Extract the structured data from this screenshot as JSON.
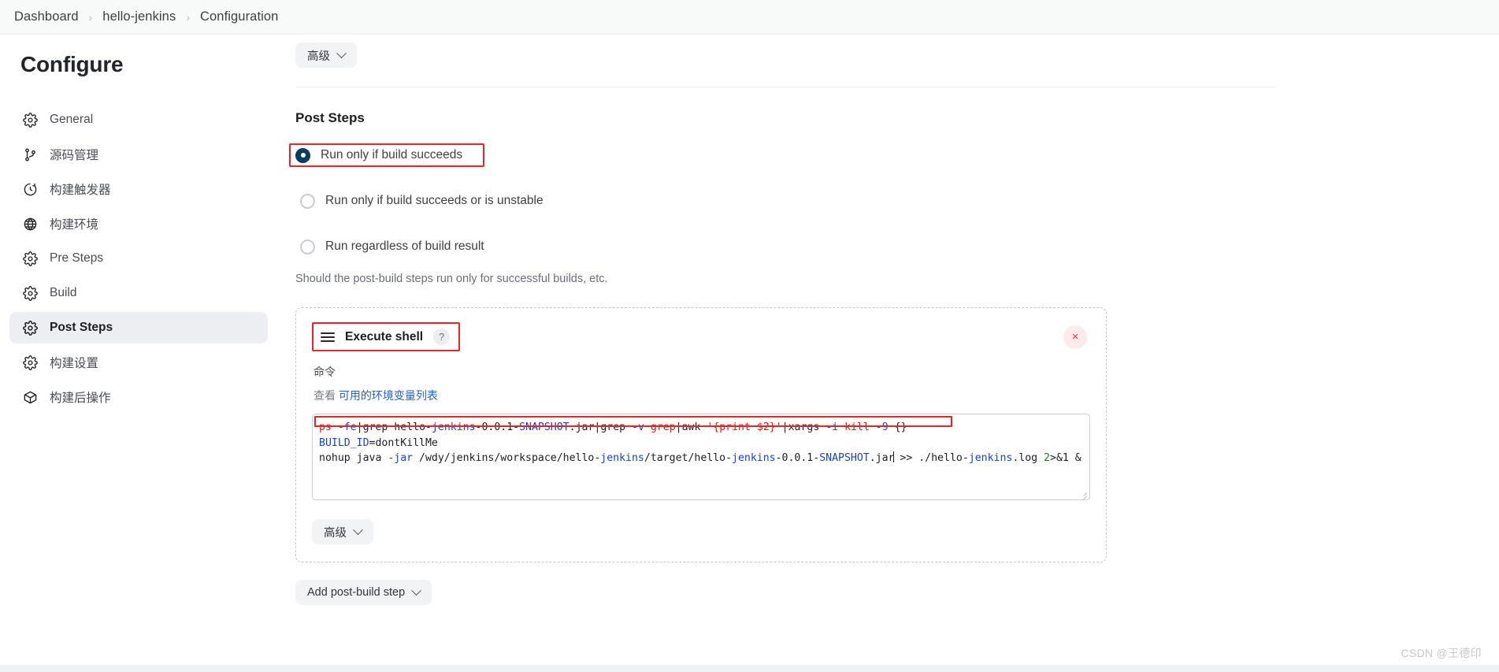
{
  "breadcrumb": {
    "items": [
      "Dashboard",
      "hello-jenkins",
      "Configuration"
    ],
    "separator": "›"
  },
  "sidebar": {
    "title": "Configure",
    "items": [
      {
        "label": "General",
        "icon": "gear-icon",
        "active": false
      },
      {
        "label": "源码管理",
        "icon": "branch-icon",
        "active": false
      },
      {
        "label": "构建触发器",
        "icon": "clock-icon",
        "active": false
      },
      {
        "label": "构建环境",
        "icon": "globe-icon",
        "active": false
      },
      {
        "label": "Pre Steps",
        "icon": "gear-icon",
        "active": false
      },
      {
        "label": "Build",
        "icon": "gear-icon",
        "active": false
      },
      {
        "label": "Post Steps",
        "icon": "gear-icon",
        "active": true
      },
      {
        "label": "构建设置",
        "icon": "gear-icon",
        "active": false
      },
      {
        "label": "构建后操作",
        "icon": "box-icon",
        "active": false
      }
    ]
  },
  "main": {
    "top_advanced_label": "高级",
    "heading": "Post Steps",
    "radios": [
      {
        "label": "Run only if build succeeds",
        "checked": true,
        "highlighted": true
      },
      {
        "label": "Run only if build succeeds or is unstable",
        "checked": false,
        "highlighted": false
      },
      {
        "label": "Run regardless of build result",
        "checked": false,
        "highlighted": false
      }
    ],
    "radio_help": "Should the post-build steps run only for successful builds, etc.",
    "shell_step": {
      "title": "Execute shell",
      "help_icon_label": "?",
      "delete_icon_label": "×",
      "command_label": "命令",
      "env_prefix": "查看",
      "env_link": "可用的环境变量列表",
      "command_value": "ps -fe|grep hello-jenkins-0.0.1-SNAPSHOT.jar|grep -v grep|awk '{print $2}'|xargs -i kill -9 {}\nBUILD_ID=dontKillMe\nnohup java -jar /wdy/jenkins/workspace/hello-jenkins/target/hello-jenkins-0.0.1-SNAPSHOT.jar >> ./hello-jenkins.log 2>&1 &",
      "inner_advanced_label": "高级"
    },
    "add_step_label": "Add post-build step"
  },
  "watermark": "CSDN @王德印",
  "colors": {
    "accent": "#0b3d63",
    "highlight": "#ee2222",
    "link": "#2563c8",
    "danger": "#e3344b"
  }
}
